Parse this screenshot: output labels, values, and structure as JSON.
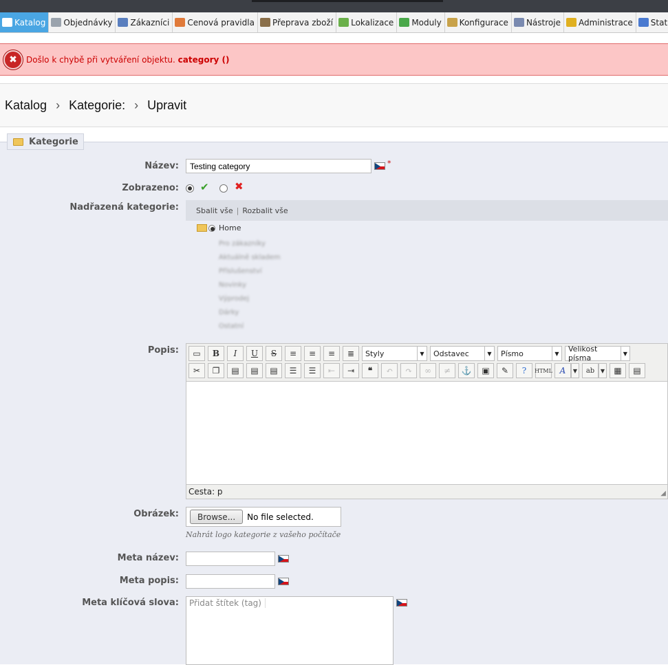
{
  "nav": {
    "tabs": [
      {
        "label": "Katalog",
        "icon": "catalog-icon",
        "color": "#ffffff",
        "active": true
      },
      {
        "label": "Objednávky",
        "icon": "cart-icon",
        "color": "#9aa3ad"
      },
      {
        "label": "Zákazníci",
        "icon": "customers-icon",
        "color": "#5a7fbf"
      },
      {
        "label": "Cenová pravidla",
        "icon": "price-rules-icon",
        "color": "#e07a3a"
      },
      {
        "label": "Přeprava zboží",
        "icon": "shipping-icon",
        "color": "#8a6f4a"
      },
      {
        "label": "Lokalizace",
        "icon": "globe-icon",
        "color": "#6bb04a"
      },
      {
        "label": "Moduly",
        "icon": "puzzle-icon",
        "color": "#4aa84a"
      },
      {
        "label": "Konfigurace",
        "icon": "settings-icon",
        "color": "#c8a24a"
      },
      {
        "label": "Nástroje",
        "icon": "wrench-icon",
        "color": "#7a8ab0"
      },
      {
        "label": "Administrace",
        "icon": "key-icon",
        "color": "#e0b020"
      },
      {
        "label": "Statistiky",
        "icon": "stats-icon",
        "color": "#4a7ad0"
      }
    ]
  },
  "error": {
    "prefix": "Došlo k chybě při vytváření objektu.",
    "object": "category ()"
  },
  "breadcrumb": {
    "items": [
      "Katalog",
      "Kategorie:",
      "Upravit"
    ],
    "separator": "›"
  },
  "fieldset": {
    "legend": "Kategorie"
  },
  "form": {
    "name": {
      "label": "Název:",
      "value": "Testing category",
      "required": "*"
    },
    "displayed": {
      "label": "Zobrazeno:",
      "yes": "✔",
      "no": "✖"
    },
    "parent": {
      "label": "Nadřazená kategorie:",
      "collapse": "Sbalit vše",
      "sep": "|",
      "expand": "Rozbalit vše",
      "root": "Home",
      "children": [
        "Pro zákazníky",
        "Aktuálně skladem",
        "Příslušenství",
        "Novinky",
        "Výprodej",
        "Dárky",
        "Ostatní"
      ]
    },
    "description": {
      "label": "Popis:",
      "styles": "Styly",
      "paragraph": "Odstavec",
      "font": "Písmo",
      "fontsize": "Velikost písma",
      "path": "Cesta: p"
    },
    "image": {
      "label": "Obrázek:",
      "button": "Browse...",
      "status": "No file selected.",
      "hint": "Nahrát logo kategorie z vašeho počítače"
    },
    "meta_title": {
      "label": "Meta název:",
      "value": ""
    },
    "meta_desc": {
      "label": "Meta popis:",
      "value": ""
    },
    "meta_keywords": {
      "label": "Meta klíčová slova:",
      "placeholder": "Přidat štítek (tag)"
    }
  }
}
